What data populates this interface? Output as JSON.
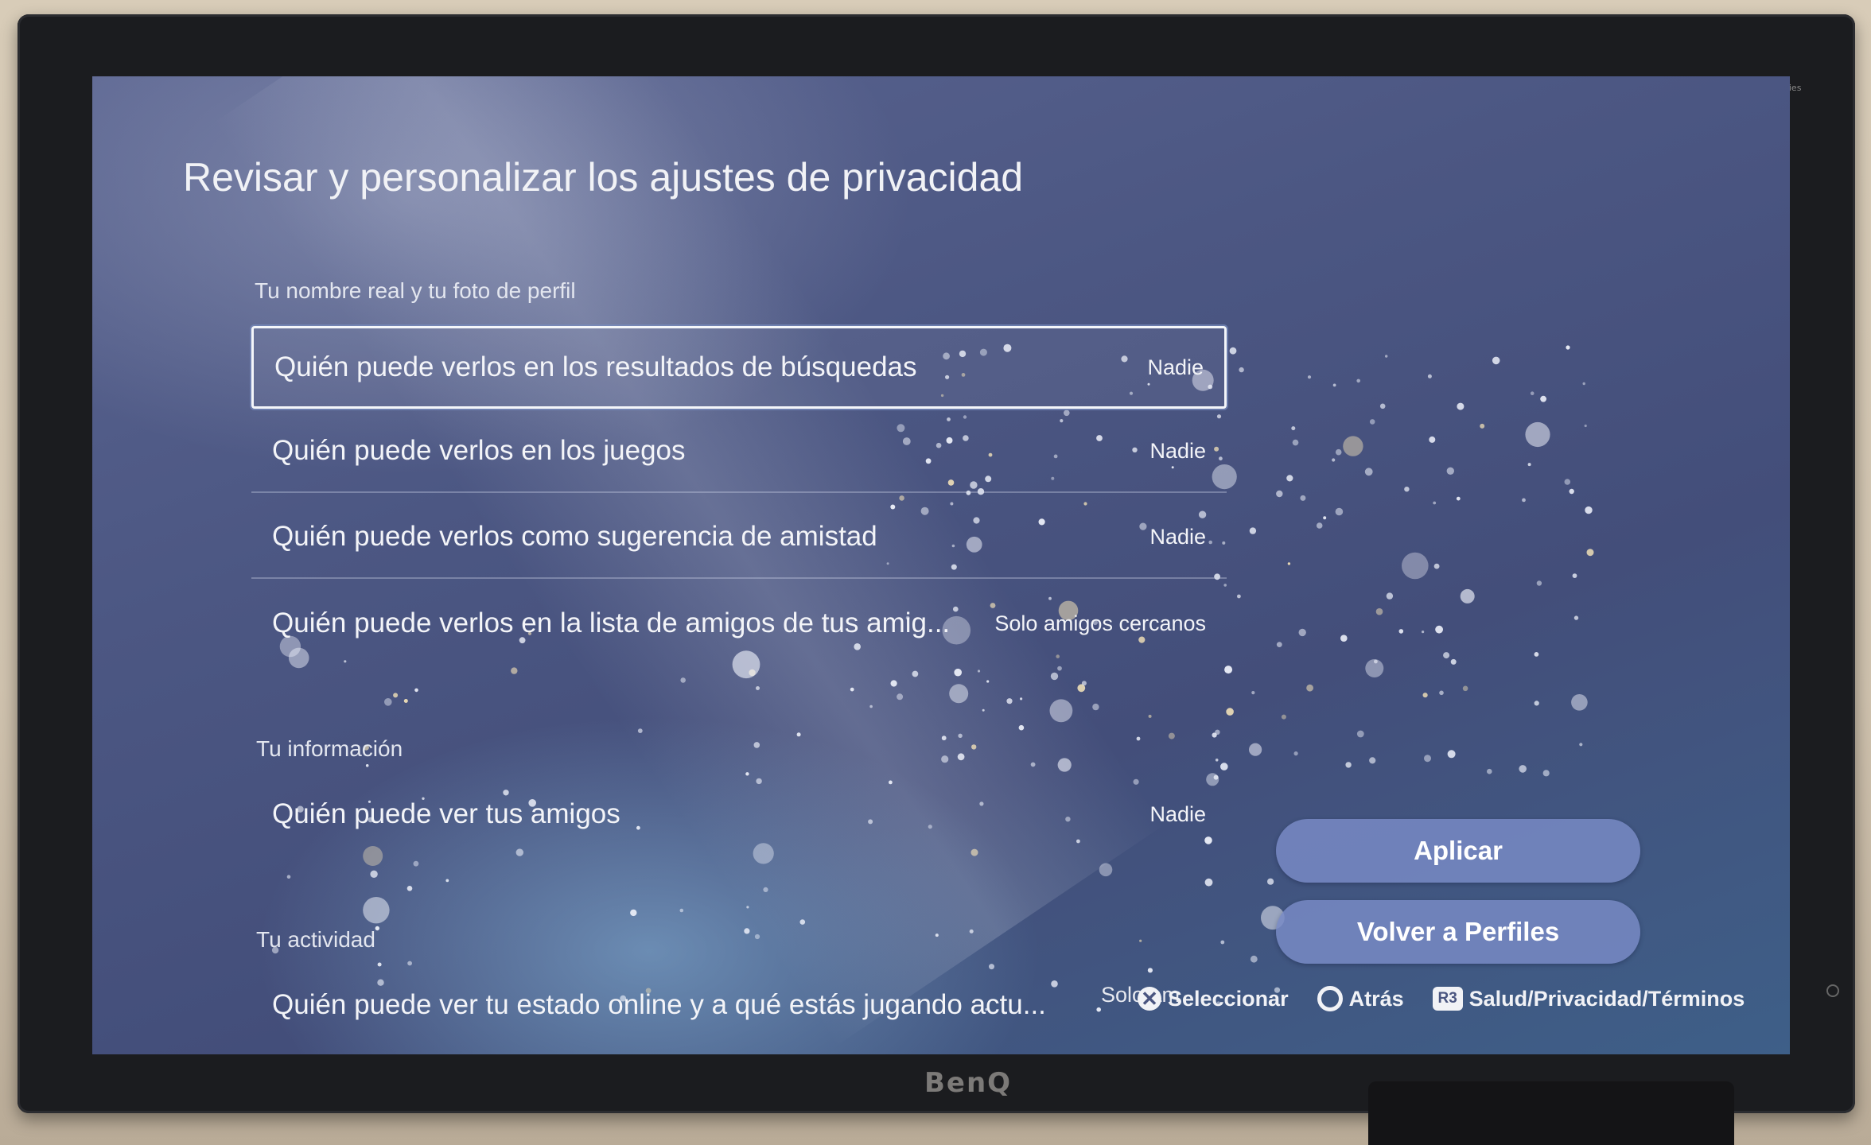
{
  "monitor": {
    "brand": "BenQ",
    "series": "PD Series"
  },
  "page": {
    "title": "Revisar y personalizar los ajustes de privacidad"
  },
  "sections": [
    {
      "label": "Tu nombre real y tu foto de perfil",
      "items": [
        {
          "label": "Quién puede verlos en los resultados de búsquedas",
          "value": "Nadie"
        },
        {
          "label": "Quién puede verlos en los juegos",
          "value": "Nadie"
        },
        {
          "label": "Quién puede verlos como sugerencia de amistad",
          "value": "Nadie"
        },
        {
          "label": "Quién puede verlos en la lista de amigos de tus amig...",
          "value": "Solo amigos cercanos"
        }
      ]
    },
    {
      "label": "Tu información",
      "items": [
        {
          "label": "Quién puede ver tus amigos",
          "value": "Nadie"
        }
      ]
    },
    {
      "label": "Tu actividad",
      "items": [
        {
          "label": "Quién puede ver tu estado online y a qué estás jugando actu...",
          "value": "Solo am"
        }
      ]
    }
  ],
  "buttons": {
    "apply": "Aplicar",
    "back_to_profiles": "Volver a Perfiles"
  },
  "footer": {
    "select": {
      "icon": "cross-button-icon",
      "label": "Seleccionar"
    },
    "back": {
      "icon": "circle-button-icon",
      "label": "Atrás"
    },
    "health": {
      "icon": "r3-button-icon",
      "icon_text": "R3",
      "label": "Salud/Privacidad/Términos"
    }
  }
}
